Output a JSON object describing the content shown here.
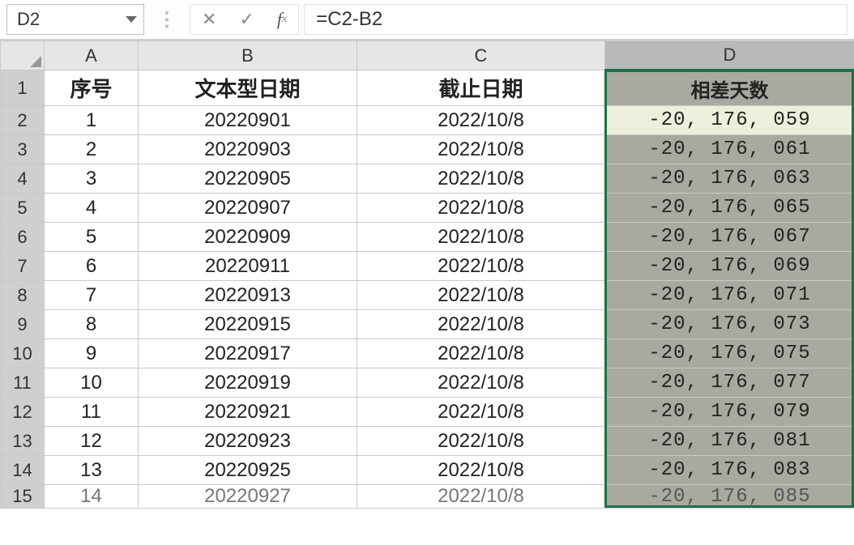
{
  "nameBox": "D2",
  "formula": "=C2-B2",
  "columns": [
    "A",
    "B",
    "C",
    "D"
  ],
  "headers": {
    "A": "序号",
    "B": "文本型日期",
    "C": "截止日期",
    "D": "相差天数"
  },
  "rows": [
    {
      "n": 2,
      "A": "1",
      "B": "20220901",
      "C": "2022/10/8",
      "D": "-20, 176, 059"
    },
    {
      "n": 3,
      "A": "2",
      "B": "20220903",
      "C": "2022/10/8",
      "D": "-20, 176, 061"
    },
    {
      "n": 4,
      "A": "3",
      "B": "20220905",
      "C": "2022/10/8",
      "D": "-20, 176, 063"
    },
    {
      "n": 5,
      "A": "4",
      "B": "20220907",
      "C": "2022/10/8",
      "D": "-20, 176, 065"
    },
    {
      "n": 6,
      "A": "5",
      "B": "20220909",
      "C": "2022/10/8",
      "D": "-20, 176, 067"
    },
    {
      "n": 7,
      "A": "6",
      "B": "20220911",
      "C": "2022/10/8",
      "D": "-20, 176, 069"
    },
    {
      "n": 8,
      "A": "7",
      "B": "20220913",
      "C": "2022/10/8",
      "D": "-20, 176, 071"
    },
    {
      "n": 9,
      "A": "8",
      "B": "20220915",
      "C": "2022/10/8",
      "D": "-20, 176, 073"
    },
    {
      "n": 10,
      "A": "9",
      "B": "20220917",
      "C": "2022/10/8",
      "D": "-20, 176, 075"
    },
    {
      "n": 11,
      "A": "10",
      "B": "20220919",
      "C": "2022/10/8",
      "D": "-20, 176, 077"
    },
    {
      "n": 12,
      "A": "11",
      "B": "20220921",
      "C": "2022/10/8",
      "D": "-20, 176, 079"
    },
    {
      "n": 13,
      "A": "12",
      "B": "20220923",
      "C": "2022/10/8",
      "D": "-20, 176, 081"
    },
    {
      "n": 14,
      "A": "13",
      "B": "20220925",
      "C": "2022/10/8",
      "D": "-20, 176, 083"
    }
  ],
  "partialRow": {
    "n": 15,
    "A": "14",
    "B": "20220927",
    "C": "2022/10/8",
    "D": "-20, 176, 085"
  },
  "selectedColumn": "D",
  "activeCell": "D2"
}
